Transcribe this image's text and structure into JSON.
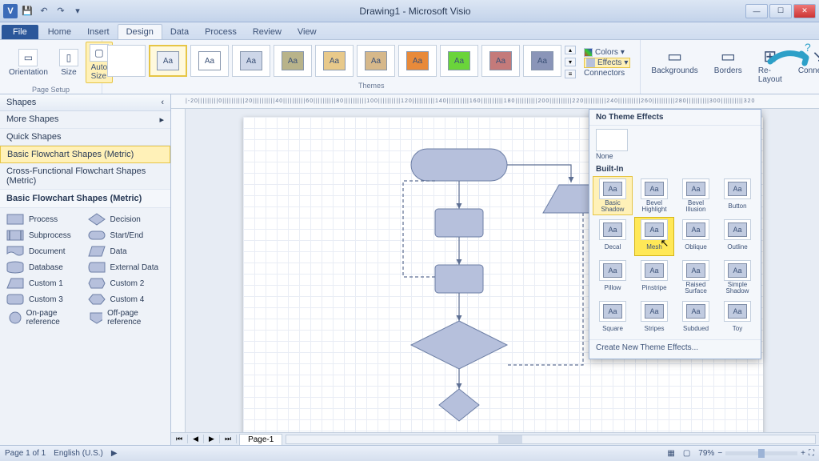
{
  "app": {
    "title": "Drawing1 - Microsoft Visio"
  },
  "tabs": {
    "file": "File",
    "items": [
      "Home",
      "Insert",
      "Design",
      "Data",
      "Process",
      "Review",
      "View"
    ],
    "active": "Design"
  },
  "ribbon": {
    "page_setup": {
      "orientation": "Orientation",
      "size": "Size",
      "autosize": "Auto\nSize",
      "group": "Page Setup"
    },
    "themes_group": "Themes",
    "theme_swatch": "Aa",
    "theme_ctrl": {
      "colors": "Colors",
      "effects": "Effects",
      "connectors": "Connectors"
    },
    "backgrounds": "Backgrounds",
    "borders": "Borders",
    "relayout": "Re-Layout",
    "conn": "Connectors"
  },
  "shapes": {
    "title": "Shapes",
    "more": "More Shapes",
    "quick": "Quick Shapes",
    "cat1": "Basic Flowchart Shapes (Metric)",
    "cat2": "Cross-Functional Flowchart Shapes (Metric)",
    "group_title": "Basic Flowchart Shapes (Metric)",
    "items": [
      {
        "n": "Process"
      },
      {
        "n": "Decision"
      },
      {
        "n": "Subprocess"
      },
      {
        "n": "Start/End"
      },
      {
        "n": "Document"
      },
      {
        "n": "Data"
      },
      {
        "n": "Database"
      },
      {
        "n": "External Data"
      },
      {
        "n": "Custom 1"
      },
      {
        "n": "Custom 2"
      },
      {
        "n": "Custom 3"
      },
      {
        "n": "Custom 4"
      },
      {
        "n": "On-page reference"
      },
      {
        "n": "Off-page reference"
      }
    ]
  },
  "effects": {
    "header": "No Theme Effects",
    "none": "None",
    "builtin": "Built-In",
    "items": [
      "Basic Shadow",
      "Bevel Highlight",
      "Bevel Illusion",
      "Button",
      "Decal",
      "Mesh",
      "Oblique",
      "Outline",
      "Pillow",
      "Pinstripe",
      "Raised Surface",
      "Simple Shadow",
      "Square",
      "Stripes",
      "Subdued",
      "Toy"
    ],
    "selected": "Basic Shadow",
    "hover": "Mesh",
    "create": "Create New Theme Effects...",
    "aa": "Aa"
  },
  "page_tab": "Page-1",
  "status": {
    "page": "Page 1 of 1",
    "lang": "English (U.S.)",
    "zoom": "79%"
  },
  "ruler_marks": "|-20|||||||||0||||||||||20||||||||||40||||||||||60||||||||||80||||||||||100||||||||||120||||||||||140||||||||||160||||||||||180||||||||||200||||||||||220||||||||||240||||||||||260||||||||||280||||||||||300||||||||||320"
}
